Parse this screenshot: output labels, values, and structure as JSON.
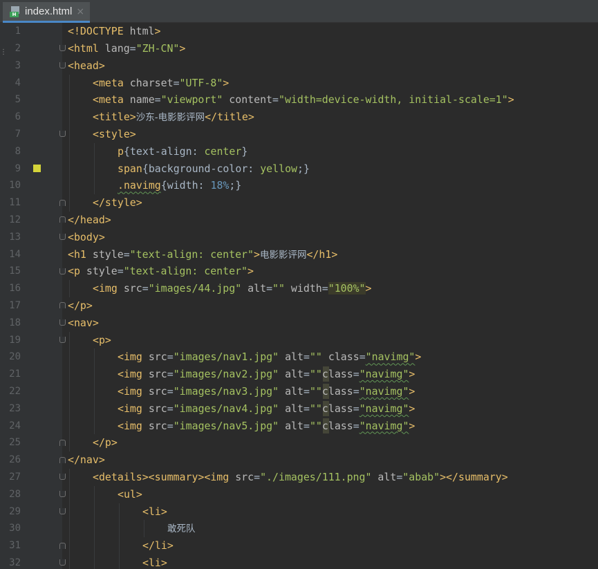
{
  "editor": {
    "tab": {
      "label": "index.html",
      "close_glyph": "×",
      "icon": "html-file-icon",
      "badge_text": "H"
    },
    "scroll_marker": "⋮",
    "bookmark_color": "#d4d43a"
  },
  "lines": [
    {
      "n": "1",
      "ind": 0,
      "tokens": [
        [
          "t",
          "<!DOCTYPE "
        ],
        [
          "a",
          "html"
        ],
        [
          "t",
          ">"
        ]
      ]
    },
    {
      "n": "2",
      "ind": 0,
      "fold": "start",
      "tokens": [
        [
          "t",
          "<html "
        ],
        [
          "a",
          "lang"
        ],
        [
          "p",
          "="
        ],
        [
          "v",
          "\"ZH-CN\""
        ],
        [
          "t",
          ">"
        ]
      ]
    },
    {
      "n": "3",
      "ind": 0,
      "fold": "start",
      "tokens": [
        [
          "t",
          "<head>"
        ]
      ]
    },
    {
      "n": "4",
      "ind": 1,
      "tokens": [
        [
          "t",
          "<meta "
        ],
        [
          "a",
          "charset"
        ],
        [
          "p",
          "="
        ],
        [
          "v",
          "\"UTF-8\""
        ],
        [
          "t",
          ">"
        ]
      ]
    },
    {
      "n": "5",
      "ind": 1,
      "tokens": [
        [
          "t",
          "<meta "
        ],
        [
          "a",
          "name"
        ],
        [
          "p",
          "="
        ],
        [
          "v",
          "\"viewport\""
        ],
        [
          "a",
          " content"
        ],
        [
          "p",
          "="
        ],
        [
          "v",
          "\"width=device-width, initial-scale=1\""
        ],
        [
          "t",
          ">"
        ]
      ]
    },
    {
      "n": "6",
      "ind": 1,
      "tokens": [
        [
          "t",
          "<title>"
        ],
        [
          "cj",
          "沙东-电影影评网"
        ],
        [
          "t",
          "</title>"
        ]
      ]
    },
    {
      "n": "7",
      "ind": 1,
      "fold": "start",
      "tokens": [
        [
          "t",
          "<style>"
        ]
      ]
    },
    {
      "n": "8",
      "ind": 2,
      "tokens": [
        [
          "t",
          "p"
        ],
        [
          "p",
          "{text-align: "
        ],
        [
          "v",
          "center"
        ],
        [
          "p",
          "}"
        ]
      ]
    },
    {
      "n": "9",
      "ind": 2,
      "bookmark": true,
      "tokens": [
        [
          "t",
          "span"
        ],
        [
          "p",
          "{background-color: "
        ],
        [
          "v",
          "yellow"
        ],
        [
          "p",
          ";}"
        ]
      ]
    },
    {
      "n": "10",
      "ind": 2,
      "tokens": [
        [
          "tsq",
          ".navimg"
        ],
        [
          "p",
          "{width: "
        ],
        [
          "n",
          "18%"
        ],
        [
          "p",
          ";}"
        ]
      ]
    },
    {
      "n": "11",
      "ind": 1,
      "fold": "end",
      "tokens": [
        [
          "t",
          "</style>"
        ]
      ]
    },
    {
      "n": "12",
      "ind": 0,
      "fold": "end",
      "tokens": [
        [
          "t",
          "</head>"
        ]
      ]
    },
    {
      "n": "13",
      "ind": 0,
      "fold": "start",
      "tokens": [
        [
          "t",
          "<body>"
        ]
      ]
    },
    {
      "n": "14",
      "ind": 0,
      "tokens": [
        [
          "t",
          "<h1 "
        ],
        [
          "a",
          "style"
        ],
        [
          "p",
          "="
        ],
        [
          "v",
          "\"text-align: center\""
        ],
        [
          "t",
          ">"
        ],
        [
          "cj",
          "电影影评网"
        ],
        [
          "t",
          "</h1>"
        ]
      ]
    },
    {
      "n": "15",
      "ind": 0,
      "fold": "start",
      "tokens": [
        [
          "t",
          "<p "
        ],
        [
          "a",
          "style"
        ],
        [
          "p",
          "="
        ],
        [
          "v",
          "\"text-align: center\""
        ],
        [
          "t",
          ">"
        ]
      ]
    },
    {
      "n": "16",
      "ind": 1,
      "tokens": [
        [
          "t",
          "<img "
        ],
        [
          "a",
          "src"
        ],
        [
          "p",
          "="
        ],
        [
          "v",
          "\"images/44.jpg\""
        ],
        [
          "a",
          " alt"
        ],
        [
          "p",
          "="
        ],
        [
          "v",
          "\"\""
        ],
        [
          "a",
          " width"
        ],
        [
          "p",
          "="
        ],
        [
          "vhl",
          "\"100%\""
        ],
        [
          "t",
          ">"
        ]
      ]
    },
    {
      "n": "17",
      "ind": 0,
      "fold": "end",
      "tokens": [
        [
          "t",
          "</p>"
        ]
      ]
    },
    {
      "n": "18",
      "ind": 0,
      "fold": "start",
      "tokens": [
        [
          "t",
          "<nav>"
        ]
      ]
    },
    {
      "n": "19",
      "ind": 1,
      "fold": "start",
      "tokens": [
        [
          "t",
          "<p>"
        ]
      ]
    },
    {
      "n": "20",
      "ind": 2,
      "tokens": [
        [
          "t",
          "<img "
        ],
        [
          "a",
          "src"
        ],
        [
          "p",
          "="
        ],
        [
          "v",
          "\"images/nav1.jpg\""
        ],
        [
          "a",
          " alt"
        ],
        [
          "p",
          "="
        ],
        [
          "v",
          "\"\""
        ],
        [
          "a",
          " class"
        ],
        [
          "p",
          "="
        ],
        [
          "vsq",
          "\"navimg\""
        ],
        [
          "t",
          ">"
        ]
      ]
    },
    {
      "n": "21",
      "ind": 2,
      "caret": true,
      "tokens": [
        [
          "t",
          "<img "
        ],
        [
          "a",
          "src"
        ],
        [
          "p",
          "="
        ],
        [
          "v",
          "\"images/nav2.jpg\""
        ],
        [
          "a",
          " alt"
        ],
        [
          "p",
          "="
        ],
        [
          "v",
          "\"\""
        ],
        [
          "a",
          "class"
        ],
        [
          "p",
          "="
        ],
        [
          "vsq",
          "\"navimg\""
        ],
        [
          "t",
          ">"
        ]
      ]
    },
    {
      "n": "22",
      "ind": 2,
      "caret": true,
      "tokens": [
        [
          "t",
          "<img "
        ],
        [
          "a",
          "src"
        ],
        [
          "p",
          "="
        ],
        [
          "v",
          "\"images/nav3.jpg\""
        ],
        [
          "a",
          " alt"
        ],
        [
          "p",
          "="
        ],
        [
          "v",
          "\"\""
        ],
        [
          "a",
          "class"
        ],
        [
          "p",
          "="
        ],
        [
          "vsq",
          "\"navimg\""
        ],
        [
          "t",
          ">"
        ]
      ]
    },
    {
      "n": "23",
      "ind": 2,
      "caret": true,
      "tokens": [
        [
          "t",
          "<img "
        ],
        [
          "a",
          "src"
        ],
        [
          "p",
          "="
        ],
        [
          "v",
          "\"images/nav4.jpg\""
        ],
        [
          "a",
          " alt"
        ],
        [
          "p",
          "="
        ],
        [
          "v",
          "\"\""
        ],
        [
          "a",
          "class"
        ],
        [
          "p",
          "="
        ],
        [
          "vsq",
          "\"navimg\""
        ],
        [
          "t",
          ">"
        ]
      ]
    },
    {
      "n": "24",
      "ind": 2,
      "caret": true,
      "tokens": [
        [
          "t",
          "<img "
        ],
        [
          "a",
          "src"
        ],
        [
          "p",
          "="
        ],
        [
          "v",
          "\"images/nav5.jpg\""
        ],
        [
          "a",
          " alt"
        ],
        [
          "p",
          "="
        ],
        [
          "v",
          "\"\""
        ],
        [
          "a",
          "class"
        ],
        [
          "p",
          "="
        ],
        [
          "vsq",
          "\"navimg\""
        ],
        [
          "t",
          ">"
        ]
      ]
    },
    {
      "n": "25",
      "ind": 1,
      "fold": "end",
      "tokens": [
        [
          "t",
          "</p>"
        ]
      ]
    },
    {
      "n": "26",
      "ind": 0,
      "fold": "end",
      "tokens": [
        [
          "t",
          "</nav>"
        ]
      ]
    },
    {
      "n": "27",
      "ind": 1,
      "fold": "start",
      "tokens": [
        [
          "t",
          "<details><summary><img "
        ],
        [
          "a",
          "src"
        ],
        [
          "p",
          "="
        ],
        [
          "v",
          "\"./images/111.png\""
        ],
        [
          "a",
          " alt"
        ],
        [
          "p",
          "="
        ],
        [
          "v",
          "\"abab\""
        ],
        [
          "t",
          "></summary>"
        ]
      ]
    },
    {
      "n": "28",
      "ind": 2,
      "fold": "start",
      "tokens": [
        [
          "t",
          "<ul>"
        ]
      ]
    },
    {
      "n": "29",
      "ind": 3,
      "fold": "start",
      "tokens": [
        [
          "t",
          "<li>"
        ]
      ]
    },
    {
      "n": "30",
      "ind": 4,
      "tokens": [
        [
          "cj",
          "敢死队"
        ]
      ]
    },
    {
      "n": "31",
      "ind": 3,
      "fold": "end",
      "tokens": [
        [
          "t",
          "</li>"
        ]
      ]
    },
    {
      "n": "32",
      "ind": 3,
      "fold": "start",
      "tokens": [
        [
          "t",
          "<li>"
        ]
      ]
    }
  ]
}
